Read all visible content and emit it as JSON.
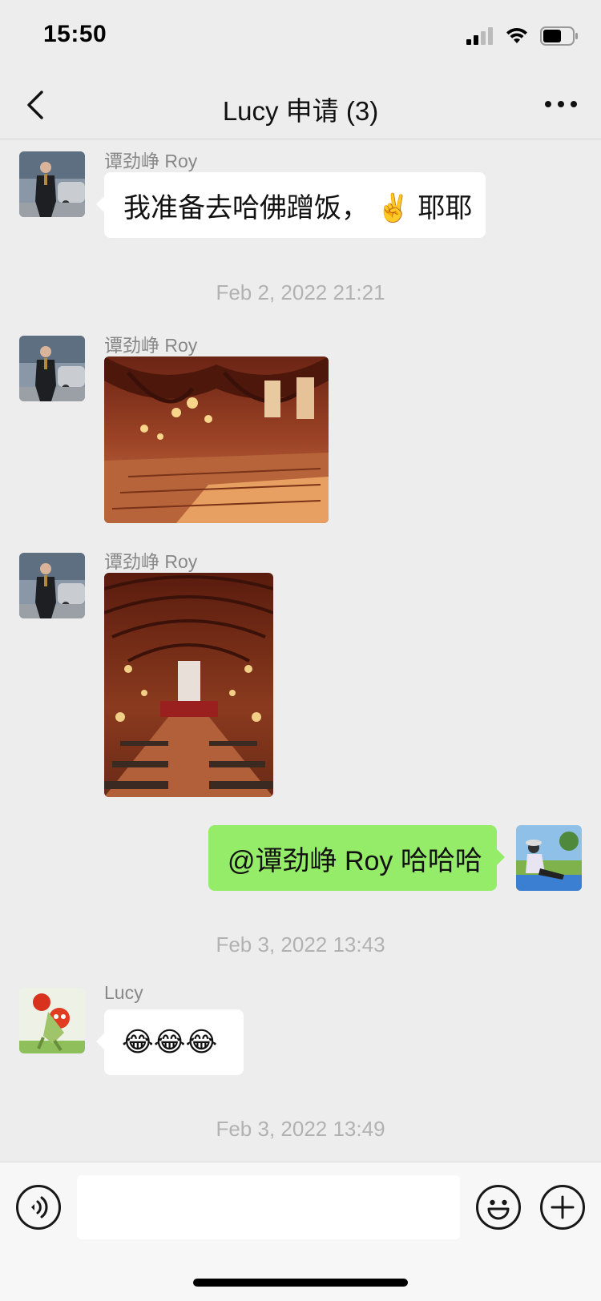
{
  "status_bar": {
    "time": "15:50"
  },
  "header": {
    "title": "Lucy 申请 (3)"
  },
  "messages": {
    "m1": {
      "sender": "谭劲峥 Roy",
      "text": "我准备去哈佛蹭饭， ✌️ 耶耶"
    },
    "ts1": "Feb 2, 2022 21:21",
    "m2": {
      "sender": "谭劲峥 Roy",
      "image": "photo-dining-hall-wide"
    },
    "m3": {
      "sender": "谭劲峥 Roy",
      "image": "photo-dining-hall-tall"
    },
    "m4": {
      "text": "@谭劲峥 Roy 哈哈哈"
    },
    "ts2": "Feb 3, 2022 13:43",
    "m5": {
      "sender": "Lucy",
      "text": "😂😂😂"
    },
    "ts3": "Feb 3, 2022 13:49"
  },
  "input": {
    "placeholder": ""
  },
  "colors": {
    "background": "#ededed",
    "outgoing_bubble": "#95ec69",
    "incoming_bubble": "#ffffff"
  },
  "icons": [
    "back-chevron-icon",
    "more-dots-icon",
    "voice-icon",
    "emoji-icon",
    "plus-icon",
    "signal-icon",
    "wifi-icon",
    "battery-icon"
  ]
}
